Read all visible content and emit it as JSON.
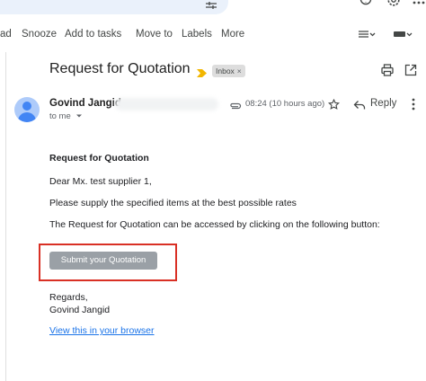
{
  "toolbar": {
    "partial_first": "ad",
    "snooze": "Snooze",
    "add_to_tasks": "Add to tasks",
    "move_to": "Move to",
    "labels": "Labels",
    "more": "More"
  },
  "subject": {
    "title": "Request for Quotation",
    "chip": "Inbox",
    "chip_close": "×"
  },
  "sender": {
    "name": "Govind Jangid",
    "to": "to me",
    "time": "08:24 (10 hours ago)",
    "reply": "Reply"
  },
  "message": {
    "heading": "Request for Quotation",
    "greeting": "Dear Mx. test supplier 1,",
    "line1": "Please supply the specified items at the best possible rates",
    "line2": "The Request for Quotation can be accessed by clicking on the following button:",
    "button": "Submit your Quotation",
    "regards": "Regards,",
    "signature": "Govind Jangid",
    "link": "View this in your browser"
  },
  "icons": {
    "filter": "tune-icon",
    "help": "help-icon",
    "settings": "gear-icon",
    "apps": "apps-icon",
    "important": "important-marker-icon",
    "print": "print-icon",
    "popout": "open-in-new-icon",
    "attachment": "attachment-icon",
    "star": "star-icon",
    "reply": "reply-icon",
    "more": "more-vert-icon"
  },
  "colors": {
    "accent": "#1a73e8",
    "highlight": "#d93025",
    "button": "#9aa0a6",
    "important": "#f2b600"
  }
}
